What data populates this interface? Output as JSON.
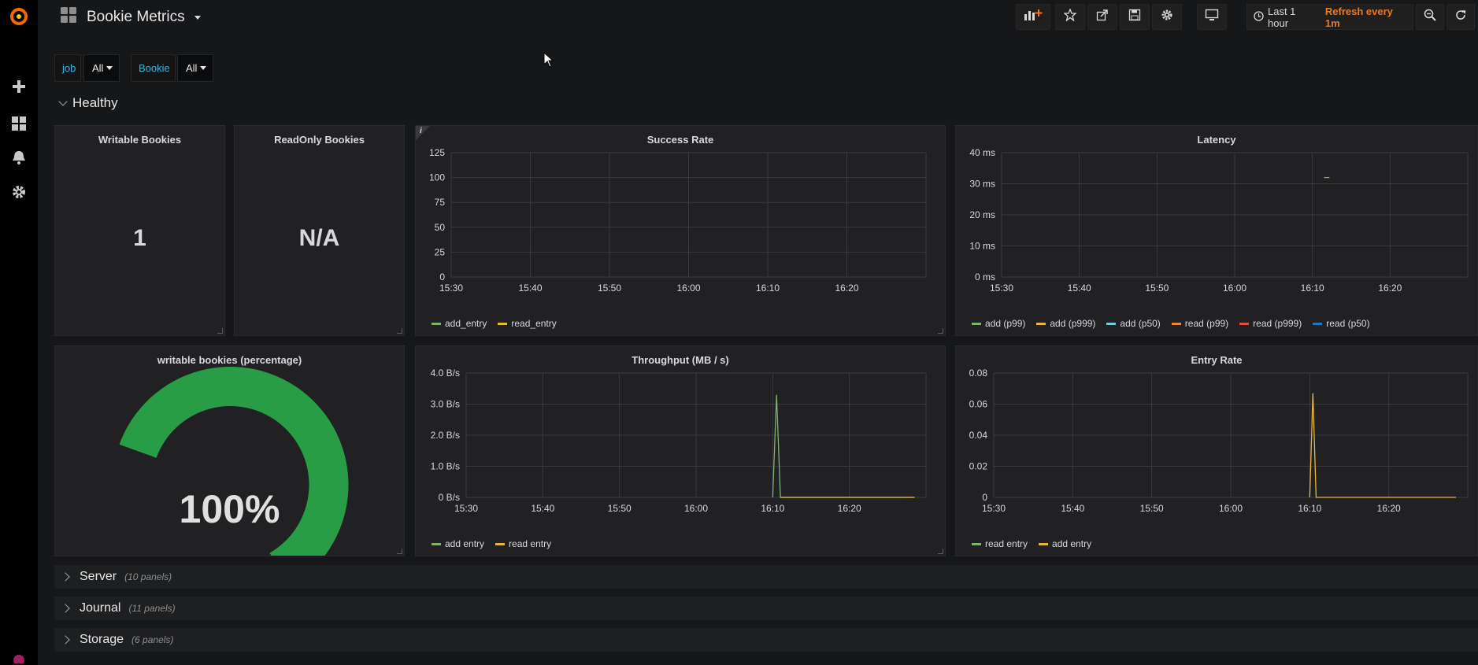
{
  "dashboard": {
    "title": "Bookie Metrics",
    "time_range": "Last 1 hour",
    "refresh": "Refresh every 1m"
  },
  "variables": [
    {
      "label": "job",
      "value": "All"
    },
    {
      "label": "Bookie",
      "value": "All"
    }
  ],
  "rows": {
    "healthy": "Healthy",
    "collapsed": [
      {
        "name": "Server",
        "count": "(10 panels)"
      },
      {
        "name": "Journal",
        "count": "(11 panels)"
      },
      {
        "name": "Storage",
        "count": "(6 panels)"
      }
    ]
  },
  "icons": {
    "sidebar": [
      "grafana-logo-icon",
      "plus-icon",
      "dashboards-icon",
      "bell-icon",
      "gear-icon"
    ],
    "toolbar": [
      "add-panel-icon",
      "star-icon",
      "share-icon",
      "save-icon",
      "settings-icon",
      "tv-mode-icon",
      "clock-icon",
      "zoom-out-icon",
      "refresh-icon"
    ]
  },
  "panels": {
    "writable_bookies": {
      "title": "Writable Bookies",
      "value": "1"
    },
    "readonly_bookies": {
      "title": "ReadOnly Bookies",
      "value": "N/A"
    },
    "writable_pct": {
      "title": "writable bookies (percentage)",
      "value": "100%",
      "gauge_fraction": 1.0,
      "color": "#299c46"
    }
  },
  "chart_data": [
    {
      "id": "success_rate",
      "type": "line",
      "title": "Success Rate",
      "x_ticks": [
        "15:30",
        "15:40",
        "15:50",
        "16:00",
        "16:10",
        "16:20"
      ],
      "y_ticks": [
        "125",
        "100",
        "75",
        "50",
        "25",
        "0"
      ],
      "ylim": [
        0,
        125
      ],
      "series": [
        {
          "name": "add_entry",
          "color": "#7eb26d",
          "points": []
        },
        {
          "name": "read_entry",
          "color": "#eab839",
          "points": []
        }
      ]
    },
    {
      "id": "latency",
      "type": "line",
      "title": "Latency",
      "x_ticks": [
        "15:30",
        "15:40",
        "15:50",
        "16:00",
        "16:10",
        "16:20"
      ],
      "y_ticks": [
        "40 ms",
        "30 ms",
        "20 ms",
        "10 ms",
        "0 ms"
      ],
      "ylim": [
        0,
        40
      ],
      "series": [
        {
          "name": "add (p99)",
          "color": "#7eb26d",
          "points": [
            [
              41.5,
              32
            ],
            [
              42.2,
              32
            ]
          ]
        },
        {
          "name": "add (p999)",
          "color": "#eab839",
          "points": []
        },
        {
          "name": "add (p50)",
          "color": "#6ed0e0",
          "points": []
        },
        {
          "name": "read (p99)",
          "color": "#ef843c",
          "points": []
        },
        {
          "name": "read (p999)",
          "color": "#e24d42",
          "points": []
        },
        {
          "name": "read (p50)",
          "color": "#1f78c1",
          "points": []
        }
      ]
    },
    {
      "id": "throughput",
      "type": "line",
      "title": "Throughput (MB / s)",
      "x_ticks": [
        "15:30",
        "15:40",
        "15:50",
        "16:00",
        "16:10",
        "16:20"
      ],
      "y_ticks": [
        "4.0 B/s",
        "3.0 B/s",
        "2.0 B/s",
        "1.0 B/s",
        "0 B/s"
      ],
      "ylim": [
        0,
        4
      ],
      "series": [
        {
          "name": "add entry",
          "color": "#7eb26d",
          "points": [
            [
              40,
              0
            ],
            [
              40.5,
              3.3
            ],
            [
              41,
              0
            ],
            [
              58.5,
              0
            ]
          ]
        },
        {
          "name": "read entry",
          "color": "#eab839",
          "points": [
            [
              41,
              0
            ],
            [
              58.5,
              0
            ]
          ]
        }
      ]
    },
    {
      "id": "entry_rate",
      "type": "line",
      "title": "Entry Rate",
      "x_ticks": [
        "15:30",
        "15:40",
        "15:50",
        "16:00",
        "16:10",
        "16:20"
      ],
      "y_ticks": [
        "0.08",
        "0.06",
        "0.04",
        "0.02",
        "0"
      ],
      "ylim": [
        0,
        0.08
      ],
      "series": [
        {
          "name": "read entry",
          "color": "#7eb26d",
          "points": []
        },
        {
          "name": "add entry",
          "color": "#eab839",
          "points": [
            [
              40,
              0
            ],
            [
              40.4,
              0.067
            ],
            [
              40.8,
              0
            ],
            [
              58.5,
              0
            ]
          ]
        }
      ]
    }
  ]
}
